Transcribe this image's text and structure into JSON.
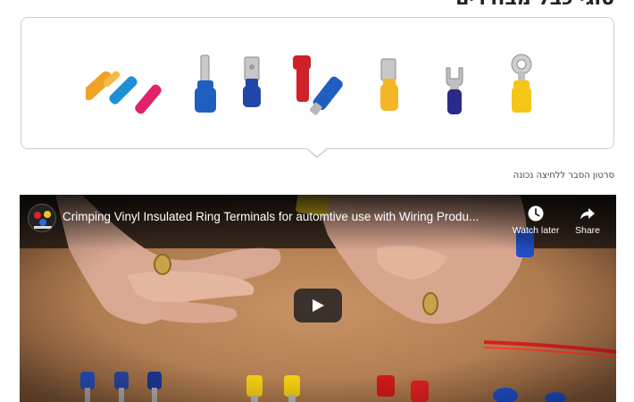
{
  "heading": "סוגי כבל מבודדים",
  "gallery": {
    "items": [
      {
        "name": "butt-connectors"
      },
      {
        "name": "pin-terminal"
      },
      {
        "name": "male-spade-terminal"
      },
      {
        "name": "female-spade-terminals"
      },
      {
        "name": "flat-female-terminal"
      },
      {
        "name": "fork-terminal"
      },
      {
        "name": "ring-terminal"
      }
    ]
  },
  "caption": "סרטון הסבר ללחיצה נכונה",
  "video": {
    "title": "Crimping Vinyl Insulated Ring Terminals for automtive use with Wiring Produ...",
    "watch_later_label": "Watch later",
    "share_label": "Share"
  },
  "colors": {
    "border": "#cfcfcf",
    "youtube_play_bg": "#212121",
    "terminal_yellow": "#f5c518",
    "terminal_blue": "#1f5fbf",
    "terminal_red": "#d0202a",
    "terminal_orange": "#f2a127"
  }
}
